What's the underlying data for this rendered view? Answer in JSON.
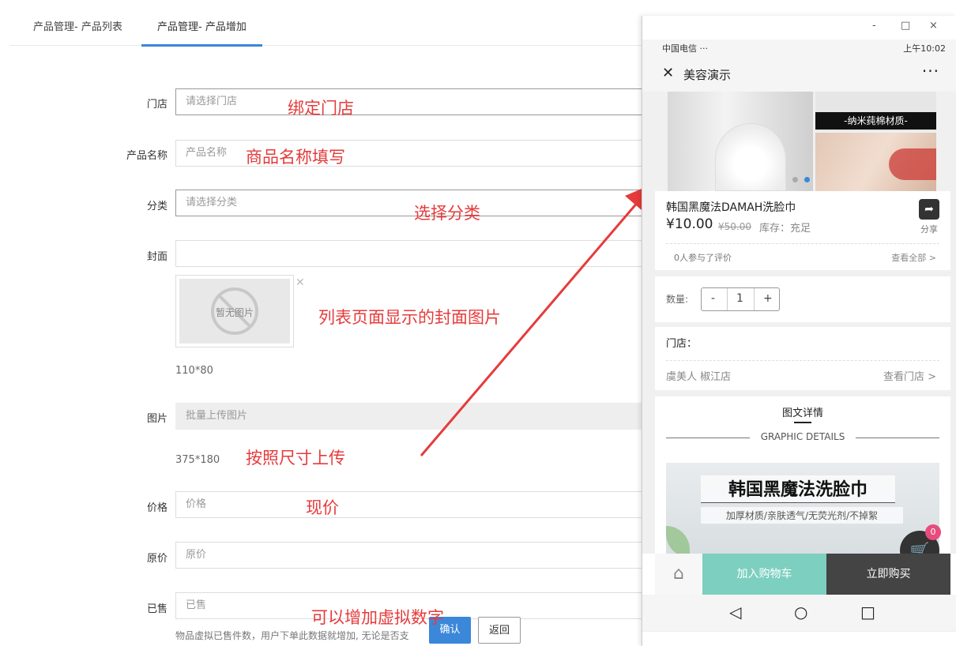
{
  "tabs": [
    {
      "label": "产品管理- 产品列表"
    },
    {
      "label": "产品管理- 产品增加"
    }
  ],
  "form": {
    "store": {
      "label": "门店",
      "placeholder": "请选择门店"
    },
    "name": {
      "label": "产品名称",
      "placeholder": "产品名称"
    },
    "category": {
      "label": "分类",
      "placeholder": "请选择分类"
    },
    "cover": {
      "label": "封面",
      "image_text": "暂无图片",
      "size_hint": "110*80"
    },
    "images": {
      "label": "图片",
      "button": "批量上传图片",
      "size_hint": "375*180"
    },
    "price": {
      "label": "价格",
      "placeholder": "价格"
    },
    "original_price": {
      "label": "原价",
      "placeholder": "原价"
    },
    "sold": {
      "label": "已售",
      "placeholder": "已售",
      "description": "物品虚拟已售件数，用户下单此数据就增加, 无论是否支"
    },
    "confirm": "确认",
    "back": "返回"
  },
  "notes": {
    "store": "绑定门店",
    "name": "商品名称填写",
    "category": "选择分类",
    "cover": "列表页面显示的封面图片",
    "images": "按照尺寸上传",
    "price": "现价",
    "sold": "可以增加虚拟数字"
  },
  "phone": {
    "window": {
      "minimize": "-",
      "maximize": "□",
      "close": "×"
    },
    "status_left": "中国电信 ···",
    "status_right": "上午10:02",
    "title": "美容演示",
    "more": "···",
    "gallery_band": "-纳米莼棉材质-",
    "product_name": "韩国黑魔法DAMAH洗脸巾",
    "price": "¥10.00",
    "original_price": "¥50.00",
    "stock": "库存：充足",
    "share": "分享",
    "reviews": "0人参与了评价",
    "all_reviews": "查看全部 >",
    "quantity_label": "数量:",
    "quantity": "1",
    "minus": "-",
    "plus": "+",
    "store_label": "门店：",
    "store_name": "虞美人 椒江店",
    "view_store": "查看门店 >",
    "detail_title": "图文详情",
    "detail_subtitle": "GRAPHIC DETAILS",
    "banner_title": "韩国黑魔法洗脸巾",
    "banner_subtitle": "加厚材质/亲肤透气/无荧光剂/不掉絮",
    "cart_count": "0",
    "add_to_cart": "加入购物车",
    "buy_now": "立即购买"
  },
  "colors": {
    "accent": "#3b87d9",
    "note": "#e63b3b",
    "add_cart": "#7dcfc0",
    "buy": "#444444",
    "badge": "#e84b7d"
  }
}
